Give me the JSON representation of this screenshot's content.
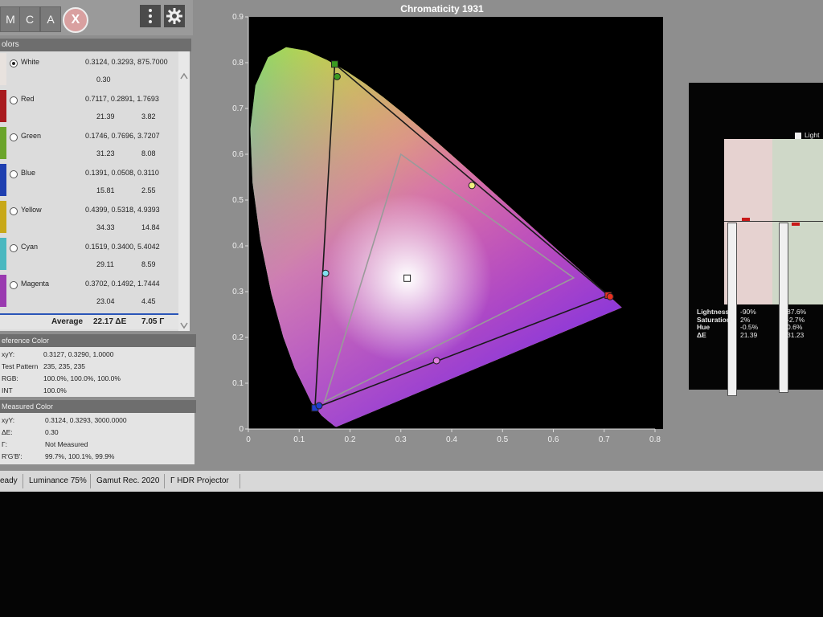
{
  "toolbar": {
    "buttons": [
      {
        "label": "M"
      },
      {
        "label": "C"
      },
      {
        "label": "A"
      }
    ],
    "close_label": "X",
    "icons": [
      "kebab-menu-icon",
      "gear-icon"
    ]
  },
  "colors_panel": {
    "header": "olors",
    "rows": [
      {
        "name": "White",
        "xyz": "0.3124, 0.3293, 875.7000",
        "de": "0.30",
        "gamma": "",
        "swatch": "#e8e2de",
        "selected": true
      },
      {
        "name": "Red",
        "xyz": "0.7117, 0.2891, 1.7693",
        "de": "21.39",
        "gamma": "3.82",
        "swatch": "#a81a1e",
        "selected": false
      },
      {
        "name": "Green",
        "xyz": "0.1746, 0.7696, 3.7207",
        "de": "31.23",
        "gamma": "8.08",
        "swatch": "#6aa42a",
        "selected": false
      },
      {
        "name": "Blue",
        "xyz": "0.1391, 0.0508, 0.3110",
        "de": "15.81",
        "gamma": "2.55",
        "swatch": "#1e3fb0",
        "selected": false
      },
      {
        "name": "Yellow",
        "xyz": "0.4399, 0.5318, 4.9393",
        "de": "34.33",
        "gamma": "14.84",
        "swatch": "#c8a818",
        "selected": false
      },
      {
        "name": "Cyan",
        "xyz": "0.1519, 0.3400, 5.4042",
        "de": "29.11",
        "gamma": "8.59",
        "swatch": "#4ab8c0",
        "selected": false
      },
      {
        "name": "Magenta",
        "xyz": "0.3702, 0.1492, 1.7444",
        "de": "23.04",
        "gamma": "4.45",
        "swatch": "#9a3ab0",
        "selected": false
      }
    ],
    "average_label": "Average",
    "average_de": "22.17 ΔE",
    "average_gamma": "7.05 Γ"
  },
  "reference": {
    "header": "eference Color",
    "rows": [
      {
        "key": "xyY:",
        "value": "0.3127, 0.3290, 1.0000"
      },
      {
        "key": "Test Pattern",
        "value": "235, 235, 235"
      },
      {
        "key": "RGB:",
        "value": "100.0%, 100.0%, 100.0%"
      },
      {
        "key": "INT",
        "value": "100.0%"
      }
    ]
  },
  "measured": {
    "header": "Measured Color",
    "rows": [
      {
        "key": "xyY:",
        "value": "0.3124, 0.3293, 3000.0000"
      },
      {
        "key": "ΔE:",
        "value": "0.30"
      },
      {
        "key": "Γ:",
        "value": "Not Measured"
      },
      {
        "key": "R'G'B':",
        "value": "99.7%, 100.1%, 99.9%"
      }
    ]
  },
  "status_bar": {
    "ready": "eady",
    "luminance": "Luminance 75%",
    "gamut": "Gamut Rec. 2020",
    "profile": "Γ HDR Projector"
  },
  "chart_data": {
    "type": "scatter",
    "title": "Chromaticity 1931",
    "xlabel": "",
    "ylabel": "",
    "xlim": [
      0,
      0.8
    ],
    "ylim": [
      0,
      0.9
    ],
    "xticks": [
      "0",
      "0.1",
      "0.2",
      "0.3",
      "0.4",
      "0.5",
      "0.6",
      "0.7",
      "0.8"
    ],
    "yticks": [
      "0",
      "0.1",
      "0.2",
      "0.3",
      "0.4",
      "0.5",
      "0.6",
      "0.7",
      "0.8",
      "0.9"
    ],
    "grid": false,
    "series": [
      {
        "points": [
          [
            0.708,
            0.292
          ],
          [
            0.17,
            0.797
          ],
          [
            0.131,
            0.046
          ]
        ]
      },
      {
        "points": [
          [
            0.64,
            0.33
          ],
          [
            0.3,
            0.6
          ],
          [
            0.15,
            0.06
          ]
        ]
      },
      {
        "points": [
          [
            0.7117,
            0.2891
          ],
          [
            0.1746,
            0.7696
          ],
          [
            0.1391,
            0.0508
          ],
          [
            0.4399,
            0.5318
          ],
          [
            0.1519,
            0.34
          ],
          [
            0.3702,
            0.1492
          ],
          [
            0.3124,
            0.3293
          ]
        ]
      }
    ]
  },
  "side_table": {
    "legend": "Light",
    "labels": [
      "Lightness",
      "Saturation",
      "Hue",
      "ΔE"
    ],
    "col1": [
      "-90%",
      "2%",
      "-0.5%",
      "21.39"
    ],
    "col2": [
      "87.6%",
      "-2.7%",
      "0.6%",
      "31.23"
    ]
  }
}
